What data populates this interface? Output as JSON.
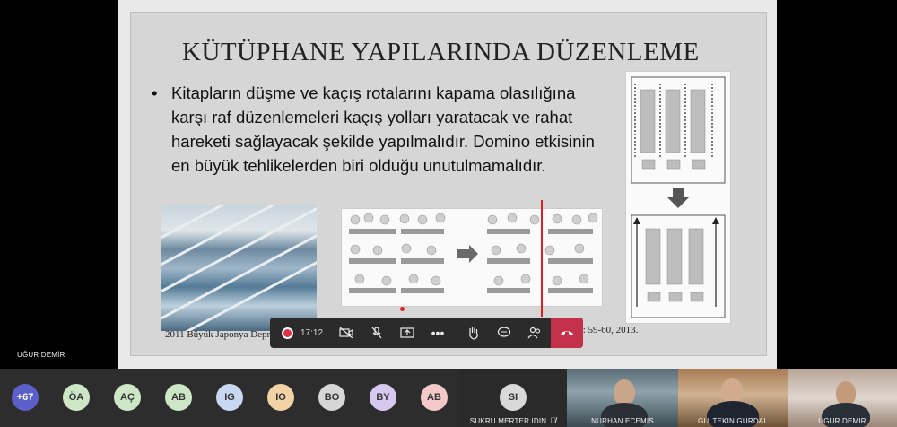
{
  "slide": {
    "title": "KÜTÜPHANE YAPILARINDA DÜZENLEME",
    "bullet": "Kitapların düşme ve kaçış rotalarını kapama olasılığına karşı raf düzenlemeleri kaçış yolları yaratacak ve rahat hareketi sağlayacak şekilde yapılmalıdır. Domino etkisinin en büyük tehlikelerden biri olduğu unutulmamalıdır.",
    "photo_caption": "2011 Büyük Japonya Depre",
    "source_caption": "Kaynak: International Preservation News, No: 59-60, 2013."
  },
  "toolbar": {
    "time": "17:12",
    "icons": [
      "record-icon",
      "camera-off-icon",
      "mic-off-icon",
      "share-screen-icon",
      "more-icon",
      "raise-hand-icon",
      "chat-icon",
      "participants-icon",
      "hang-up-icon"
    ]
  },
  "presenter": {
    "name": "UĞUR DEMİR"
  },
  "participants": {
    "overflow": "+67",
    "initials": [
      "ÖA",
      "AÇ",
      "AB",
      "IG",
      "IO",
      "BO",
      "BY",
      "AB"
    ],
    "colors": [
      "#a9c8e8",
      "#cde7c6",
      "#f2d3a8",
      "#cde7c6",
      "#c8d8f2",
      "#f2c8c8",
      "#d6d6d6",
      "#d6c8ef",
      "#f2c8c8"
    ]
  },
  "tiles": [
    {
      "name": "SUKRU MERTER IDIN",
      "initials": "SI"
    },
    {
      "name": "NURHAN ECEMIS"
    },
    {
      "name": "GULTEKIN GURDAL"
    },
    {
      "name": "UGUR DEMIR"
    }
  ],
  "colors": {
    "hangup": "#c4314b",
    "toolbar": "#2b2b2b",
    "slide_bg": "#d6d6d6"
  }
}
